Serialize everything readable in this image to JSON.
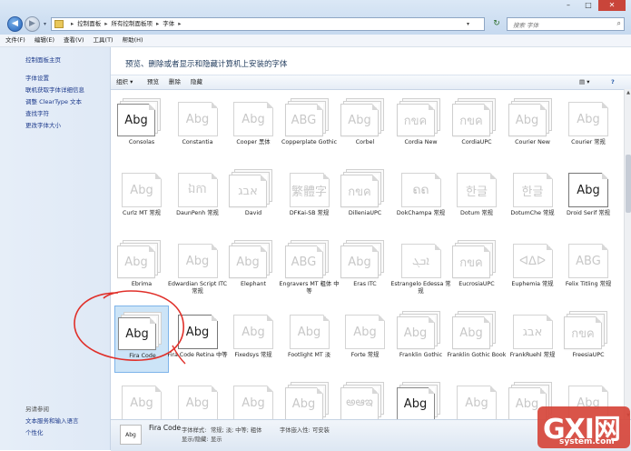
{
  "address_bar": {
    "crumbs": [
      "控制面板",
      "所有控制面板项",
      "字体"
    ],
    "search_placeholder": "搜索 字体"
  },
  "menu": [
    "文件(F)",
    "编辑(E)",
    "查看(V)",
    "工具(T)",
    "帮助(H)"
  ],
  "sidebar": {
    "home": "控制面板主页",
    "links": [
      "字体设置",
      "联机获取字体详细信息",
      "调整 ClearType 文本",
      "查找字符",
      "更改字体大小"
    ],
    "see_also_title": "另请参阅",
    "see_also": [
      "文本服务和输入语言",
      "个性化"
    ]
  },
  "heading": "预览、删除或者显示和隐藏计算机上安装的字体",
  "toolbar": {
    "organize": "组织 ▾",
    "preview": "预览",
    "delete": "删除",
    "hide": "隐藏"
  },
  "fonts": [
    {
      "name": "Consolas",
      "sample": "Abg",
      "dark": true,
      "stack": true
    },
    {
      "name": "Constantia",
      "sample": "Abg",
      "dark": false,
      "stack": false
    },
    {
      "name": "Cooper 黑体",
      "sample": "Abg",
      "dark": false,
      "stack": false
    },
    {
      "name": "Copperplate Gothic",
      "sample": "ABG",
      "dark": false,
      "stack": true
    },
    {
      "name": "Corbel",
      "sample": "Abg",
      "dark": false,
      "stack": true
    },
    {
      "name": "Cordia New",
      "sample": "กขค",
      "dark": false,
      "stack": true
    },
    {
      "name": "CordiaUPC",
      "sample": "กขค",
      "dark": false,
      "stack": true
    },
    {
      "name": "Courier New",
      "sample": "Abg",
      "dark": false,
      "stack": true
    },
    {
      "name": "Courier 常规",
      "sample": "Abg",
      "dark": false,
      "stack": false
    },
    {
      "name": "Curlz MT 常规",
      "sample": "Abg",
      "dark": false,
      "stack": false
    },
    {
      "name": "DaunPenh 常规",
      "sample": "ឯកា",
      "dark": false,
      "stack": false
    },
    {
      "name": "David",
      "sample": "אבג",
      "dark": false,
      "stack": true
    },
    {
      "name": "DFKai-SB 常规",
      "sample": "繁體字",
      "dark": false,
      "stack": false
    },
    {
      "name": "DilleniaUPC",
      "sample": "กขค",
      "dark": false,
      "stack": true
    },
    {
      "name": "DokChampa 常规",
      "sample": "ຄຄ",
      "dark": false,
      "stack": false
    },
    {
      "name": "Dotum 常规",
      "sample": "한글",
      "dark": false,
      "stack": false
    },
    {
      "name": "DotumChe 常规",
      "sample": "한글",
      "dark": false,
      "stack": false
    },
    {
      "name": "Droid Serif 常规",
      "sample": "Abg",
      "dark": true,
      "stack": false
    },
    {
      "name": "Ebrima",
      "sample": "Abg",
      "dark": false,
      "stack": true
    },
    {
      "name": "Edwardian Script ITC 常规",
      "sample": "Abg",
      "dark": false,
      "stack": false
    },
    {
      "name": "Elephant",
      "sample": "Abg",
      "dark": false,
      "stack": true
    },
    {
      "name": "Engravers MT 粗体 中等",
      "sample": "ABG",
      "dark": false,
      "stack": true
    },
    {
      "name": "Eras ITC",
      "sample": "Abg",
      "dark": false,
      "stack": true
    },
    {
      "name": "Estrangelo Edessa 常规",
      "sample": "ܐܒܓ",
      "dark": false,
      "stack": false
    },
    {
      "name": "EucrosiaUPC",
      "sample": "กขค",
      "dark": false,
      "stack": true
    },
    {
      "name": "Euphemia 常规",
      "sample": "ᐊᐃᐅ",
      "dark": false,
      "stack": false
    },
    {
      "name": "Felix Titling 常规",
      "sample": "ABG",
      "dark": false,
      "stack": false
    },
    {
      "name": "Fira Code",
      "sample": "Abg",
      "dark": true,
      "stack": true,
      "selected": true
    },
    {
      "name": "Fira Code Retina 中等",
      "sample": "Abg",
      "dark": true,
      "stack": false
    },
    {
      "name": "Fixedsys 常规",
      "sample": "Abg",
      "dark": false,
      "stack": false
    },
    {
      "name": "Footlight MT 淡",
      "sample": "Abg",
      "dark": false,
      "stack": false
    },
    {
      "name": "Forte 常规",
      "sample": "Abg",
      "dark": false,
      "stack": false
    },
    {
      "name": "Franklin Gothic",
      "sample": "Abg",
      "dark": false,
      "stack": true
    },
    {
      "name": "Franklin Gothic Book",
      "sample": "Abg",
      "dark": false,
      "stack": true
    },
    {
      "name": "FrankRuehl 常规",
      "sample": "אבג",
      "dark": false,
      "stack": false
    },
    {
      "name": "FreesiaUPC",
      "sample": "กขค",
      "dark": false,
      "stack": true
    },
    {
      "name": "Freestyle Script",
      "sample": "Abg",
      "dark": false,
      "stack": false
    },
    {
      "name": "French Script",
      "sample": "Abg",
      "dark": false,
      "stack": false
    },
    {
      "name": "Gabriola 常规",
      "sample": "Abg",
      "dark": false,
      "stack": false
    },
    {
      "name": "Garamond",
      "sample": "Abg",
      "dark": false,
      "stack": true
    },
    {
      "name": "Gautami",
      "sample": "అఆఇ",
      "dark": false,
      "stack": true
    },
    {
      "name": "Georgia",
      "sample": "Abg",
      "dark": true,
      "stack": true
    },
    {
      "name": "Gigi 常规",
      "sample": "Abg",
      "dark": false,
      "stack": false
    },
    {
      "name": "Gill Sans",
      "sample": "Abg",
      "dark": false,
      "stack": true
    },
    {
      "name": "",
      "sample": "Abg",
      "dark": false,
      "stack": false
    }
  ],
  "details": {
    "name": "Fira Code",
    "style_label": "字体样式:",
    "style_value": "常规; 淡; 中等; 粗体",
    "embed_label": "字体嵌入性:",
    "embed_value": "可安装",
    "show_label": "显示/隐藏:",
    "show_value": "显示",
    "thumb": "Abg"
  },
  "watermark": {
    "big": "GXI网",
    "small": "system.com"
  }
}
